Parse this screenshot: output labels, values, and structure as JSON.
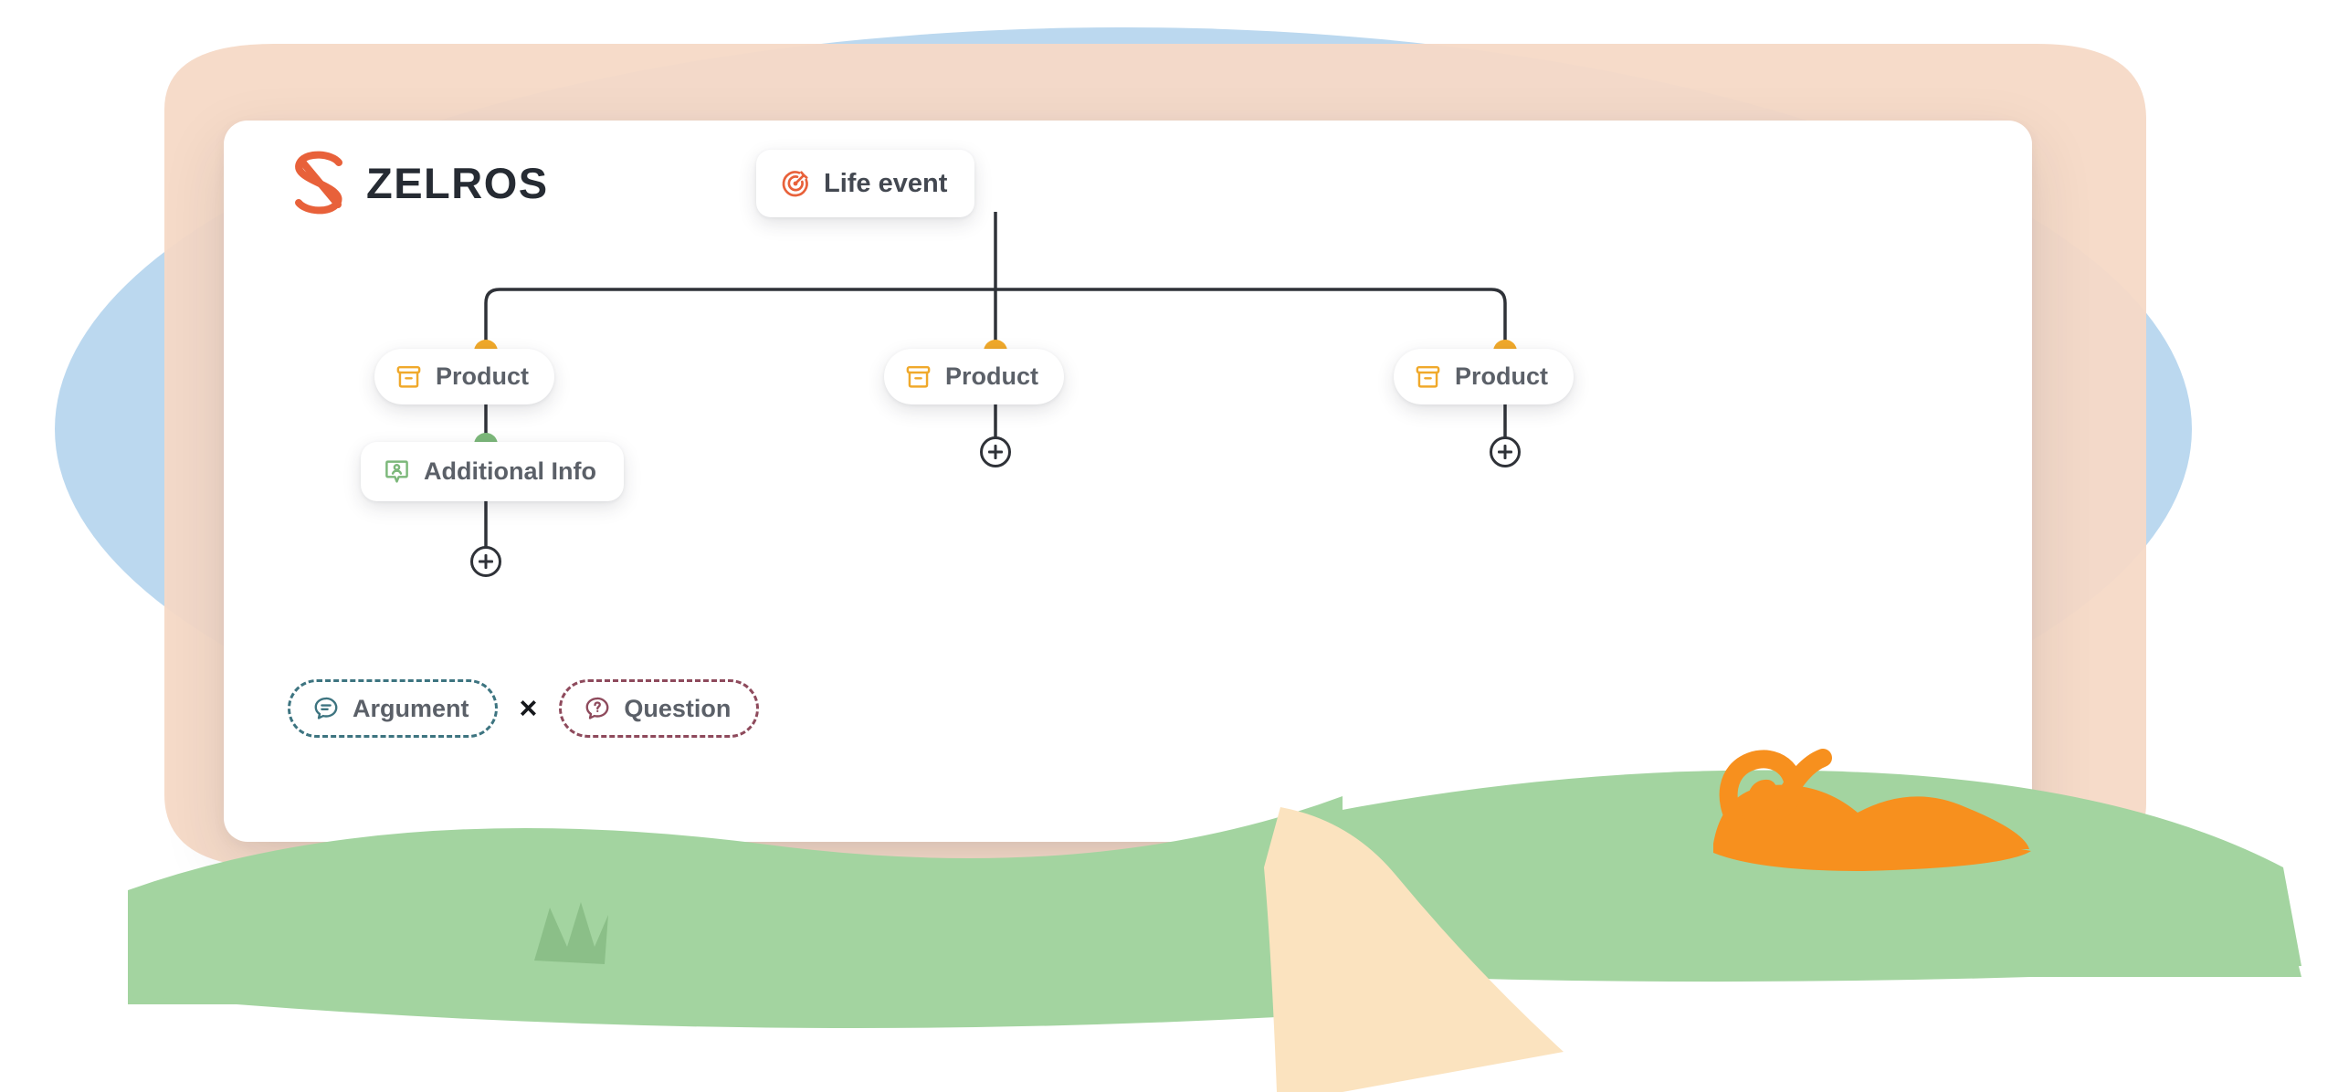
{
  "app": {
    "brand_name": "ZELROS",
    "brand_mark_icon": "zelros-z-logo-icon",
    "brand_color": "#E8613A",
    "card_background": "#FFFFFF"
  },
  "palette": {
    "sky_blue_blob": "#BBD8EF",
    "peach_blob": "#F6D9C6",
    "hill_green": "#A3D4A0",
    "grass_tuft_green": "#8BBF88",
    "path_cream": "#FBE3BF",
    "bush_orange": "#F7901E",
    "connector_line": "#2F3238",
    "product_amber": "#F0A92B",
    "info_green": "#7CB87A",
    "argument_teal": "#3D7480",
    "question_mauve": "#8E4A5C"
  },
  "flow": {
    "root": {
      "id": "life-event",
      "label": "Life event",
      "icon": "target-dart-icon",
      "icon_color": "#E8613A",
      "shape": "rounded-rect"
    },
    "products": [
      {
        "id": "product-1",
        "label": "Product",
        "icon": "archive-box-icon",
        "icon_color": "#F0A92B",
        "connector_dot_color": "#F0A92B",
        "has_add_button": false,
        "child": {
          "id": "additional-info",
          "label": "Additional Info",
          "icon": "person-badge-icon",
          "icon_color": "#7CB87A",
          "connector_dot_color": "#7CB87A",
          "has_add_button": true
        }
      },
      {
        "id": "product-2",
        "label": "Product",
        "icon": "archive-box-icon",
        "icon_color": "#F0A92B",
        "connector_dot_color": "#F0A92B",
        "has_add_button": true,
        "child": null
      },
      {
        "id": "product-3",
        "label": "Product",
        "icon": "archive-box-icon",
        "icon_color": "#F0A92B",
        "connector_dot_color": "#F0A92B",
        "has_add_button": true,
        "child": null
      }
    ],
    "add_button_label": "+"
  },
  "chips": {
    "argument": {
      "label": "Argument",
      "icon": "chat-bubble-lines-icon",
      "color": "#3D7480"
    },
    "separator": "×",
    "question": {
      "label": "Question",
      "icon": "question-bubble-icon",
      "color": "#8E4A5C"
    }
  }
}
